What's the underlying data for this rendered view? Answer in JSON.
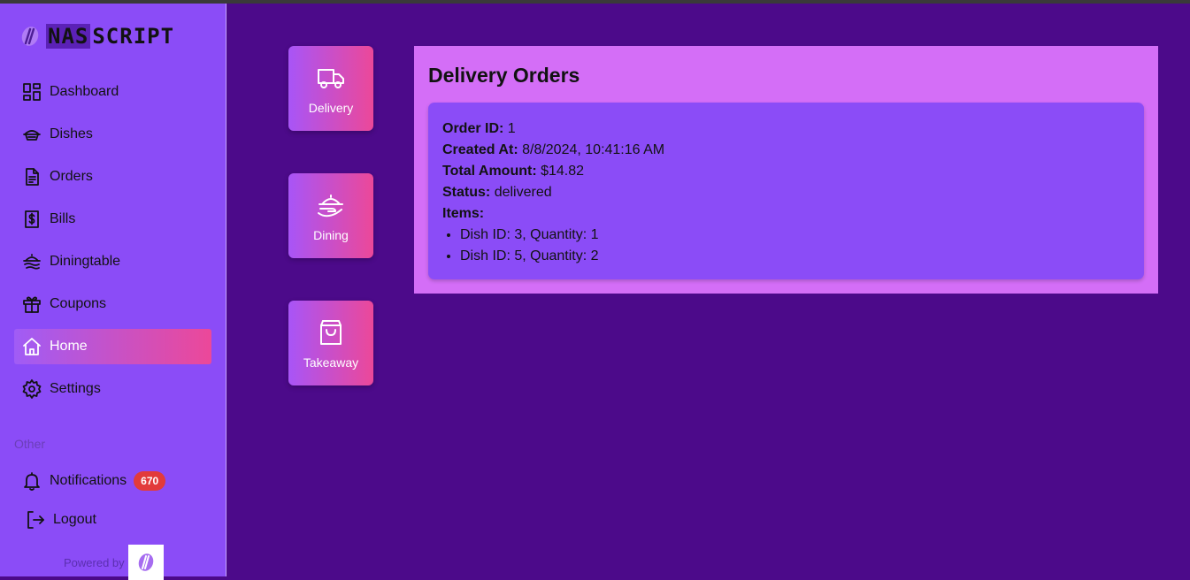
{
  "brand": {
    "logo_name": "nasscript-logo",
    "part1": "NAS",
    "part2": "SCRIPT"
  },
  "sidebar": {
    "items": [
      {
        "label": "Dashboard",
        "icon": "dashboard-grid-icon"
      },
      {
        "label": "Dishes",
        "icon": "dish-icon"
      },
      {
        "label": "Orders",
        "icon": "document-icon"
      },
      {
        "label": "Bills",
        "icon": "bill-dollar-icon"
      },
      {
        "label": "Diningtable",
        "icon": "dining-table-icon"
      },
      {
        "label": "Coupons",
        "icon": "gift-icon"
      },
      {
        "label": "Home",
        "icon": "home-icon",
        "active": true
      },
      {
        "label": "Settings",
        "icon": "gear-icon"
      }
    ],
    "other_label": "Other",
    "notifications_label": "Notifications",
    "notifications_count": "670",
    "logout_label": "Logout",
    "powered_by": "Powered by"
  },
  "tiles": [
    {
      "label": "Delivery",
      "icon": "truck-icon"
    },
    {
      "label": "Dining",
      "icon": "cloche-serving-icon"
    },
    {
      "label": "Takeaway",
      "icon": "shopping-bag-icon"
    }
  ],
  "panel": {
    "title": "Delivery Orders",
    "order": {
      "id_label": "Order ID:",
      "id": "1",
      "created_label": "Created At:",
      "created": "8/8/2024, 10:41:16 AM",
      "total_label": "Total Amount:",
      "total": "$14.82",
      "status_label": "Status:",
      "status": "delivered",
      "items_label": "Items:",
      "items": [
        "Dish ID: 3, Quantity: 1",
        "Dish ID: 5, Quantity: 2"
      ]
    }
  },
  "colors": {
    "background": "#4c0a8a",
    "sidebar": "#8b4cf7",
    "panel": "#d46ef7",
    "card": "#8b4cf7",
    "gradient_start": "#a855f7",
    "gradient_end": "#ec4899",
    "badge": "#e23b3b"
  }
}
